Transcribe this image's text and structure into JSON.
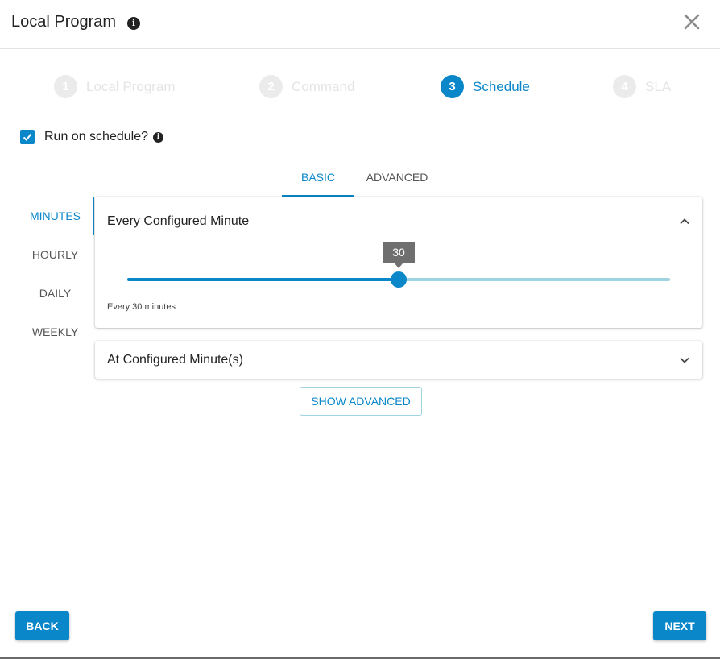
{
  "dialog": {
    "title": "Local Program",
    "title_info_icon": "info-icon",
    "close_icon": "close-icon"
  },
  "stepper": {
    "steps": [
      {
        "number": "1",
        "label": "Local Program",
        "active": false
      },
      {
        "number": "2",
        "label": "Command",
        "active": false
      },
      {
        "number": "3",
        "label": "Schedule",
        "active": true
      },
      {
        "number": "4",
        "label": "SLA",
        "active": false
      }
    ]
  },
  "schedule_toggle": {
    "label": "Run on schedule?",
    "checked": true
  },
  "tabs": {
    "items": [
      "BASIC",
      "ADVANCED"
    ],
    "selected": "BASIC"
  },
  "frequency_tabs": {
    "items": [
      "MINUTES",
      "HOURLY",
      "DAILY",
      "WEEKLY"
    ],
    "selected": "MINUTES"
  },
  "panels": {
    "every_minute": {
      "title": "Every Configured Minute",
      "expanded": true,
      "slider_value": 30,
      "slider_min": 0,
      "slider_max": 60,
      "tooltip": "30",
      "caption": "Every 30 minutes"
    },
    "at_minute": {
      "title": "At Configured Minute(s)",
      "expanded": false
    }
  },
  "show_advanced_label": "SHOW ADVANCED",
  "footer": {
    "back_label": "BACK",
    "next_label": "NEXT"
  },
  "colors": {
    "accent": "#0a87c9",
    "track_inactive": "#9fd3e0",
    "tooltip_bg": "#6f6f6f"
  }
}
